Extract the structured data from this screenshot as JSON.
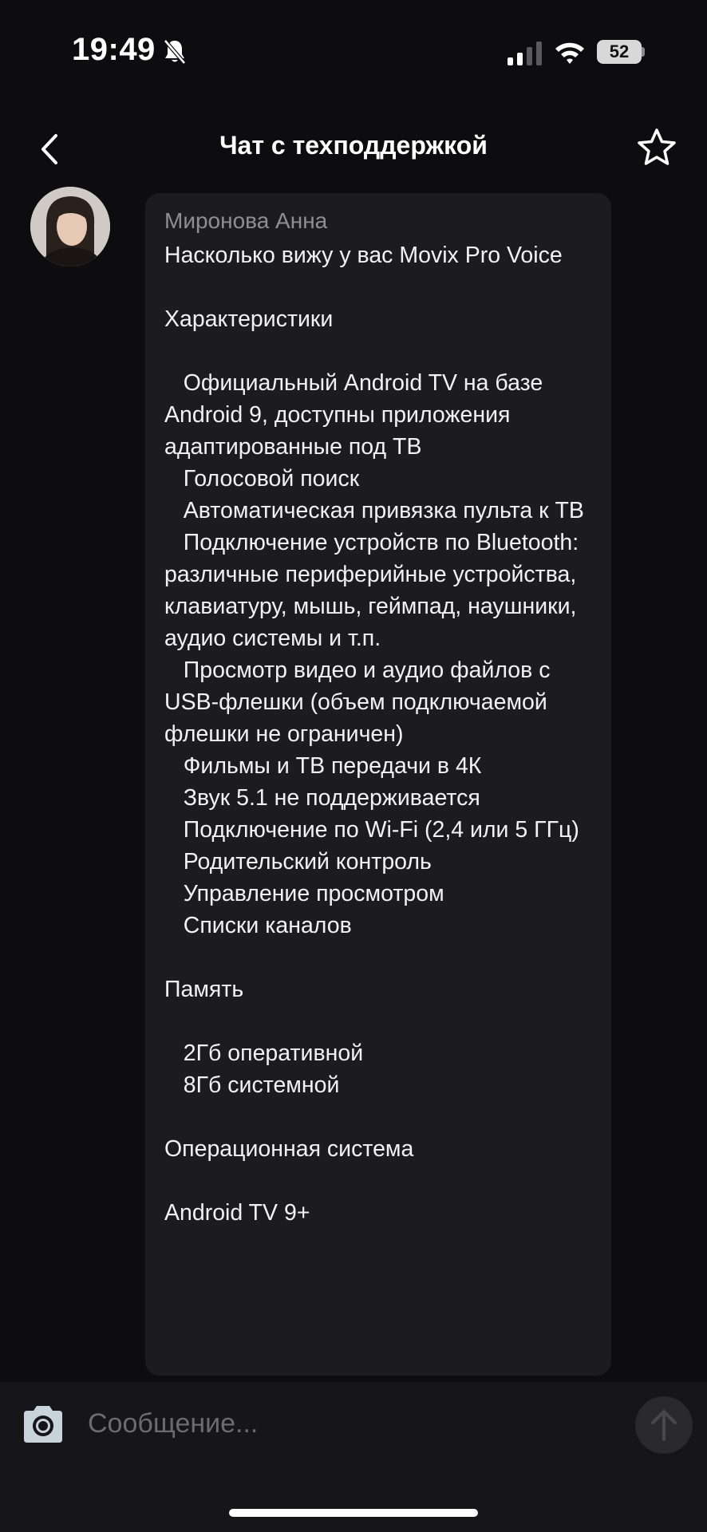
{
  "status_bar": {
    "time": "19:49",
    "battery": "52",
    "icons": [
      "bell-slash-icon",
      "cellular-signal-icon",
      "wifi-icon",
      "battery-icon"
    ]
  },
  "header": {
    "title": "Чат с техподдержкой",
    "back_icon": "chevron-left-icon",
    "favorite_icon": "star-outline-icon"
  },
  "message": {
    "sender": "Миронова Анна",
    "text": "Насколько вижу у вас Movix Pro Voice\n\nХарактеристики\n\n   Официальный Android TV на базе Android 9, доступны приложения адаптированные под ТВ\n   Голосовой поиск\n   Автоматическая привязка пульта к ТВ\n   Подключение устройств по Bluetooth: различные периферийные устройства, клавиатуру, мышь, геймпад, наушники, аудио системы и т.п.\n   Просмотр видео и аудио файлов с USB-флешки (объем подключаемой флешки не ограничен)\n   Фильмы и ТВ передачи в 4К\n   Звук 5.1 не поддерживается\n   Подключение по Wi-Fi (2,4 или 5 ГГц)\n   Родительский контроль\n   Управление просмотром\n   Списки каналов\n\nПамять\n\n   2Гб оперативной\n   8Гб системной\n\nОперационная система\n\nAndroid TV 9+"
  },
  "composer": {
    "placeholder": "Сообщение...",
    "value": "",
    "camera_icon": "camera-icon",
    "send_icon": "arrow-up-icon"
  },
  "colors": {
    "background": "#0d0d0f",
    "bubble": "#1c1c20",
    "muted_text": "#8e8e93",
    "input_bar": "#16161a"
  }
}
